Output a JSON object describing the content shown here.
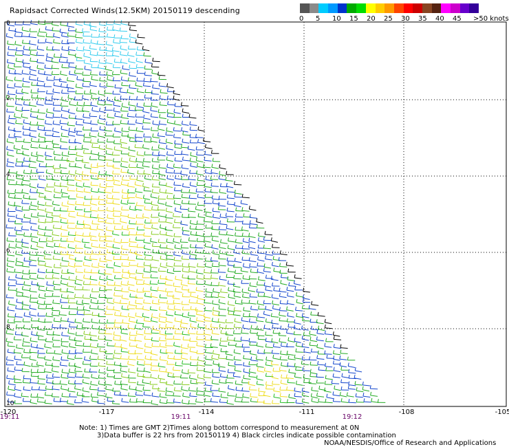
{
  "title": "Rapidsact Corrected Winds(12.5KM) 20150119 descending",
  "colorbar": {
    "colors": [
      "#555555",
      "#8a8a8a",
      "#00ccff",
      "#0099ff",
      "#0033cc",
      "#00aa00",
      "#00dd00",
      "#ffff00",
      "#ffcc00",
      "#ff9900",
      "#ff4400",
      "#ff0000",
      "#cc0000",
      "#884422",
      "#552211",
      "#ff00ff",
      "#cc00cc",
      "#6600cc",
      "#330099"
    ],
    "labels": [
      "0",
      "5",
      "10",
      "15",
      "20",
      "25",
      "30",
      "35",
      "40",
      "45",
      ">50 knots"
    ]
  },
  "axes": {
    "x_ticks": [
      "-120",
      "-117",
      "-114",
      "-111",
      "-108",
      "-105"
    ],
    "y_ticks": [
      "10",
      "8",
      "6",
      "4",
      "2",
      "0"
    ],
    "time_labels": [
      "19:11",
      "19:11",
      "19:12"
    ]
  },
  "notes": {
    "line1": "Note: 1) Times are GMT 2)Times along bottom correspond to measurement at 0N",
    "line2": "3)Data buffer is 22 hrs from 20150119 4) Black circles indicate possible contamination",
    "line3": "NOAA/NESDIS/Office of Research and Applications"
  }
}
